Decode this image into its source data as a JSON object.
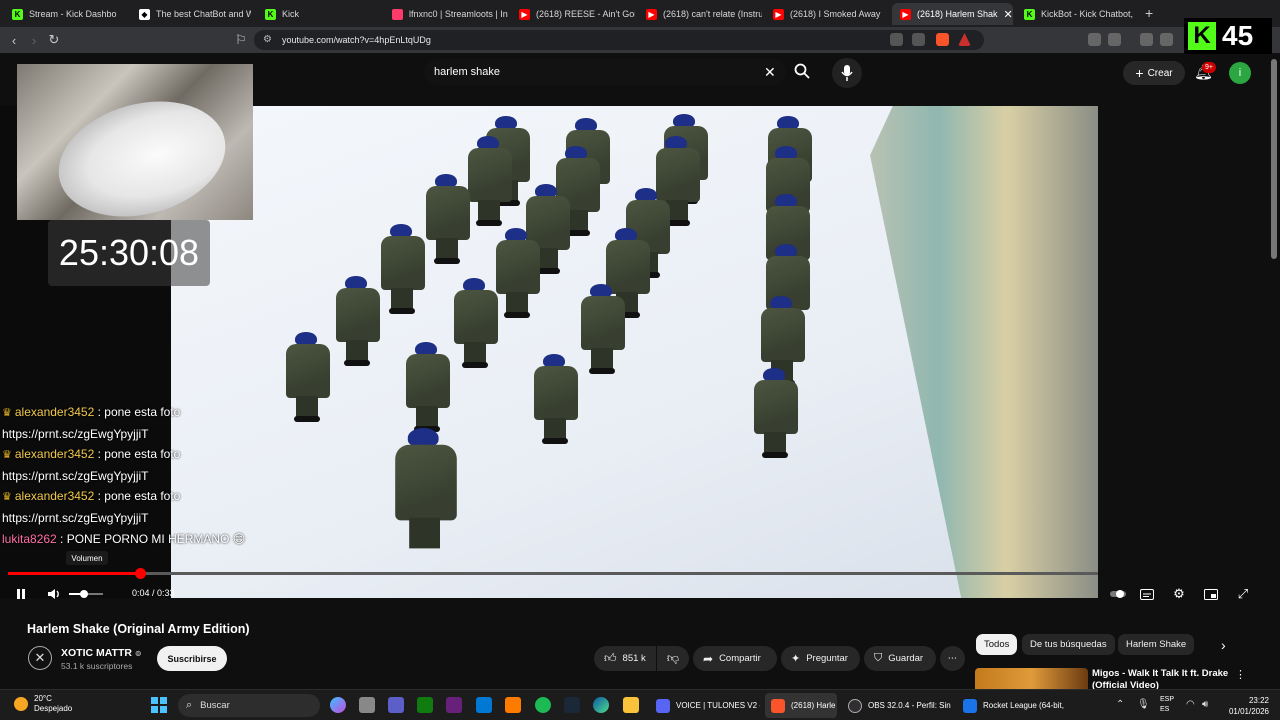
{
  "browser": {
    "tabs": [
      {
        "label": "Stream - Kick Dashbo",
        "icon": "kick-icon",
        "color": "#53fc18"
      },
      {
        "label": "The best ChatBot and Wid",
        "icon": "generic-icon",
        "color": "#ffffff"
      },
      {
        "label": "Kick",
        "icon": "kick-icon",
        "color": "#53fc18"
      },
      {
        "label": "lfnxnc0 | Streamloots | Inte",
        "icon": "streamloots-icon",
        "color": "#ff3b6b"
      },
      {
        "label": "(2618) REESE - Ain't Going",
        "icon": "youtube-icon",
        "color": "#ff0000"
      },
      {
        "label": "(2618) can't relate (Instrum",
        "icon": "youtube-icon",
        "color": "#ff0000"
      },
      {
        "label": "(2618) I Smoked Away",
        "icon": "youtube-icon",
        "color": "#ff0000"
      },
      {
        "label": "(2618) Harlem Shak",
        "icon": "youtube-icon",
        "color": "#ff0000"
      },
      {
        "label": "KickBot - Kick Chatbot, Al",
        "icon": "kick-icon",
        "color": "#53fc18"
      }
    ],
    "url": "youtube.com/watch?v=4hpEnLtqUDg"
  },
  "youtube": {
    "search_query": "harlem shake",
    "create_label": "Crear",
    "notifications_badge": "9+",
    "avatar_letter": "i"
  },
  "overlay": {
    "timer": "25:30:08",
    "kick_viewers": "45",
    "chat": [
      {
        "user": "alexander3452",
        "message": ": pone esta foto",
        "badge": true,
        "color": "user1"
      },
      {
        "user": "",
        "message": "https://prnt.sc/zgEwgYpyjjiT",
        "badge": false,
        "color": ""
      },
      {
        "user": "alexander3452",
        "message": ": pone esta foto",
        "badge": true,
        "color": "user1"
      },
      {
        "user": "",
        "message": "https://prnt.sc/zgEwgYpyjjiT",
        "badge": false,
        "color": ""
      },
      {
        "user": "alexander3452",
        "message": ": pone esta foto",
        "badge": true,
        "color": "user1"
      },
      {
        "user": "",
        "message": "https://prnt.sc/zgEwgYpyjjiT",
        "badge": false,
        "color": ""
      },
      {
        "user": "lukita8262",
        "message": ": PONE PORNO MI HERMANO 😁",
        "badge": false,
        "color": "user2"
      }
    ]
  },
  "player": {
    "volume_tooltip": "Volumen",
    "time_current": "0:04",
    "time_total": "0:33",
    "time_display": "0:04 / 0:33",
    "progress_fraction": 0.121,
    "volume_fraction": 0.45
  },
  "video": {
    "title": "Harlem Shake (Original Army Edition)",
    "channel": "XOTIC MATTR",
    "subscribers": "53.1 k suscriptores",
    "subscribe_label": "Suscribirse",
    "likes": "851 k",
    "share_label": "Compartir",
    "ask_label": "Preguntar",
    "save_label": "Guardar"
  },
  "sidebar": {
    "chips": [
      "Todos",
      "De tus búsquedas",
      "Harlem Shake"
    ],
    "recommendation_title": "Migos - Walk It Talk It ft. Drake (Official Video)"
  },
  "taskbar": {
    "weather_temp": "20°C",
    "weather_desc": "Despejado",
    "search_label": "Buscar",
    "apps": [
      {
        "label": "VOICE | TULONES V2 -",
        "color": "#5865f2"
      },
      {
        "label": "(2618) Harle",
        "color": "#fb542b"
      },
      {
        "label": "OBS 32.0.4 - Perfil: Sin",
        "color": "#302e31"
      },
      {
        "label": "Rocket League (64-bit,",
        "color": "#1a73e8"
      }
    ],
    "lang_top": "ESP",
    "lang_bottom": "ES",
    "time": "23:22",
    "date": "01/01/2026"
  }
}
